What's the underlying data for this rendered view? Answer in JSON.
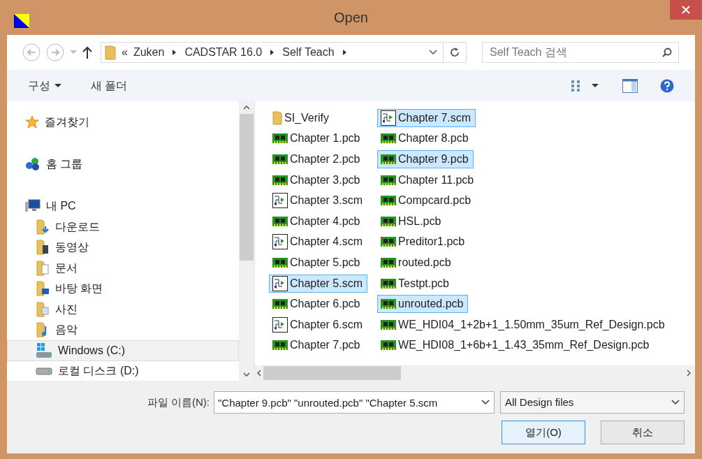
{
  "window": {
    "title": "Open"
  },
  "address_bar": {
    "overflow": "«",
    "path": [
      "Zuken",
      "CADSTAR 16.0",
      "Self Teach"
    ]
  },
  "search": {
    "placeholder": "Self Teach 검색"
  },
  "toolbar": {
    "organize": "구성",
    "new_folder": "새 폴더"
  },
  "sidebar": {
    "items": [
      {
        "label": "즐겨찾기",
        "kind": "favorites",
        "selected": false
      },
      {
        "label": "홈 그룹",
        "kind": "homegroup",
        "selected": false
      },
      {
        "label": "내 PC",
        "kind": "pc",
        "selected": false,
        "children": [
          {
            "label": "다운로드",
            "kind": "downloads",
            "selected": false
          },
          {
            "label": "동영상",
            "kind": "videos",
            "selected": false
          },
          {
            "label": "문서",
            "kind": "documents",
            "selected": false
          },
          {
            "label": "바탕 화면",
            "kind": "desktop",
            "selected": false
          },
          {
            "label": "사진",
            "kind": "pictures",
            "selected": false
          },
          {
            "label": "음악",
            "kind": "music",
            "selected": false
          },
          {
            "label": "Windows (C:)",
            "kind": "system-drive",
            "selected": true
          },
          {
            "label": "로컬 디스크 (D:)",
            "kind": "drive",
            "selected": false
          }
        ]
      }
    ]
  },
  "files": [
    {
      "name": "SI_Verify",
      "kind": "folder",
      "selected": false
    },
    {
      "name": "Chapter 1.pcb",
      "kind": "pcb",
      "selected": false
    },
    {
      "name": "Chapter 2.pcb",
      "kind": "pcb",
      "selected": false
    },
    {
      "name": "Chapter 3.pcb",
      "kind": "pcb",
      "selected": false
    },
    {
      "name": "Chapter 3.scm",
      "kind": "scm",
      "selected": false
    },
    {
      "name": "Chapter 4.pcb",
      "kind": "pcb",
      "selected": false
    },
    {
      "name": "Chapter 4.scm",
      "kind": "scm",
      "selected": false
    },
    {
      "name": "Chapter 5.pcb",
      "kind": "pcb",
      "selected": false
    },
    {
      "name": "Chapter 5.scm",
      "kind": "scm",
      "selected": true
    },
    {
      "name": "Chapter 6.pcb",
      "kind": "pcb",
      "selected": false
    },
    {
      "name": "Chapter 6.scm",
      "kind": "scm",
      "selected": false
    },
    {
      "name": "Chapter 7.pcb",
      "kind": "pcb",
      "selected": false
    },
    {
      "name": "Chapter 7.scm",
      "kind": "scm",
      "selected": true
    },
    {
      "name": "Chapter 8.pcb",
      "kind": "pcb",
      "selected": false
    },
    {
      "name": "Chapter 9.pcb",
      "kind": "pcb",
      "selected": true
    },
    {
      "name": "Chapter 11.pcb",
      "kind": "pcb",
      "selected": false
    },
    {
      "name": "Compcard.pcb",
      "kind": "pcb",
      "selected": false
    },
    {
      "name": "HSL.pcb",
      "kind": "pcb",
      "selected": false
    },
    {
      "name": "Preditor1.pcb",
      "kind": "pcb",
      "selected": false
    },
    {
      "name": "routed.pcb",
      "kind": "pcb",
      "selected": false
    },
    {
      "name": "Testpt.pcb",
      "kind": "pcb",
      "selected": false
    },
    {
      "name": "unrouted.pcb",
      "kind": "pcb",
      "selected": true
    },
    {
      "name": "WE_HDI04_1+2b+1_1.50mm_35um_Ref_Design.pcb",
      "kind": "pcb",
      "selected": false
    },
    {
      "name": "WE_HDI08_1+6b+1_1.43_35mm_Ref_Design.pcb",
      "kind": "pcb",
      "selected": false
    }
  ],
  "file_name": {
    "label": "파일 이름(N):",
    "value": "\"Chapter 9.pcb\" \"unrouted.pcb\" \"Chapter 5.scm"
  },
  "file_type": {
    "value": "All Design files"
  },
  "buttons": [
    {
      "label": "열기(O)",
      "kind": "primary"
    },
    {
      "label": "취소",
      "kind": "secondary"
    }
  ]
}
